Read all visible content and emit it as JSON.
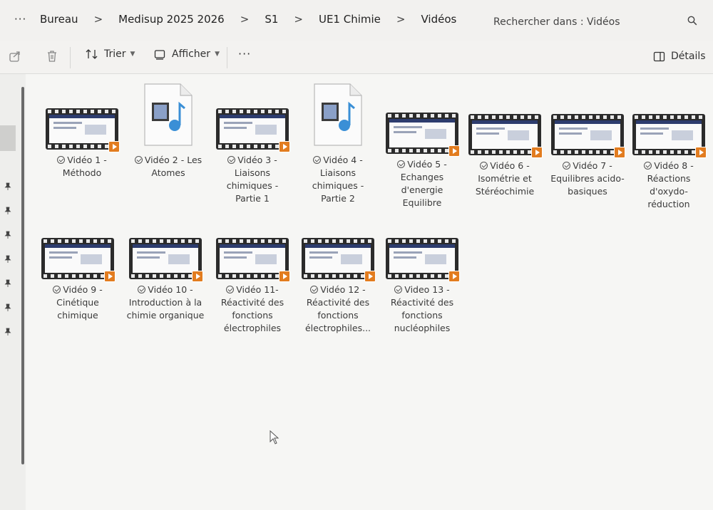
{
  "address": {
    "more_label": "···",
    "breadcrumbs": [
      "Bureau",
      "Medisup 2025 2026",
      "S1",
      "UE1 Chimie",
      "Vidéos"
    ],
    "separator": ">"
  },
  "search": {
    "placeholder": "Rechercher dans : Vidéos"
  },
  "toolbar": {
    "sort_label": "Trier",
    "view_label": "Afficher",
    "more_label": "···",
    "details_label": "Détails"
  },
  "files": [
    {
      "name": "Vidéo 1 - Méthodo",
      "thumb": "film"
    },
    {
      "name": "Vidéo 2 - Les Atomes",
      "thumb": "doc"
    },
    {
      "name": "Vidéo 3 - Liaisons chimiques - Partie 1",
      "thumb": "film"
    },
    {
      "name": "Vidéo 4 - Liaisons chimiques - Partie 2",
      "thumb": "doc"
    },
    {
      "name": "Vidéo 5 - Echanges d'energie Equilibre",
      "thumb": "film"
    },
    {
      "name": "Vidéo 6 - Isométrie et Stéréochimie",
      "thumb": "film"
    },
    {
      "name": "Vidéo 7 - Equilibres acido-basiques",
      "thumb": "film"
    },
    {
      "name": "Vidéo 8 - Réactions d'oxydo-réduction",
      "thumb": "film"
    },
    {
      "name": "Vidéo 9 - Cinétique chimique",
      "thumb": "film"
    },
    {
      "name": "Vidéo 10 - Introduction à la chimie organique",
      "thumb": "film"
    },
    {
      "name": "Vidéo 11- Réactivité des fonctions électrophiles",
      "thumb": "film"
    },
    {
      "name": "Vidéo 12 - Réactivité des fonctions électrophiles...",
      "thumb": "film"
    },
    {
      "name": "Video 13 - Réactivité des fonctions nucléophiles",
      "thumb": "film"
    }
  ],
  "colors": {
    "play_badge": "#e27c1f",
    "media_icon": "#3a8fd6"
  }
}
